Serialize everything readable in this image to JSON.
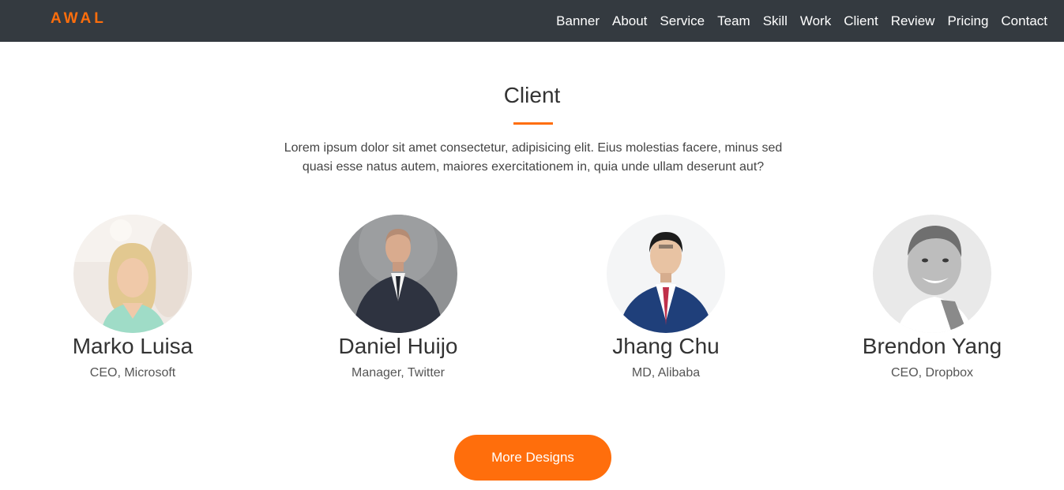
{
  "brand": "AWAL",
  "nav": [
    "Banner",
    "About",
    "Service",
    "Team",
    "Skill",
    "Work",
    "Client",
    "Review",
    "Pricing",
    "Contact"
  ],
  "section": {
    "title": "Client",
    "description": "Lorem ipsum dolor sit amet consectetur, adipisicing elit. Eius molestias facere, minus sed quasi esse natus autem, maiores exercitationem in, quia unde ullam deserunt aut?"
  },
  "clients": [
    {
      "name": "Marko Luisa",
      "role": "CEO, Microsoft"
    },
    {
      "name": "Daniel Huijo",
      "role": "Manager, Twitter"
    },
    {
      "name": "Jhang Chu",
      "role": "MD, Alibaba"
    },
    {
      "name": "Brendon Yang",
      "role": "CEO, Dropbox"
    }
  ],
  "button": {
    "label": "More Designs"
  },
  "colors": {
    "accent": "#ff6e0c",
    "navbar": "#343a40"
  }
}
